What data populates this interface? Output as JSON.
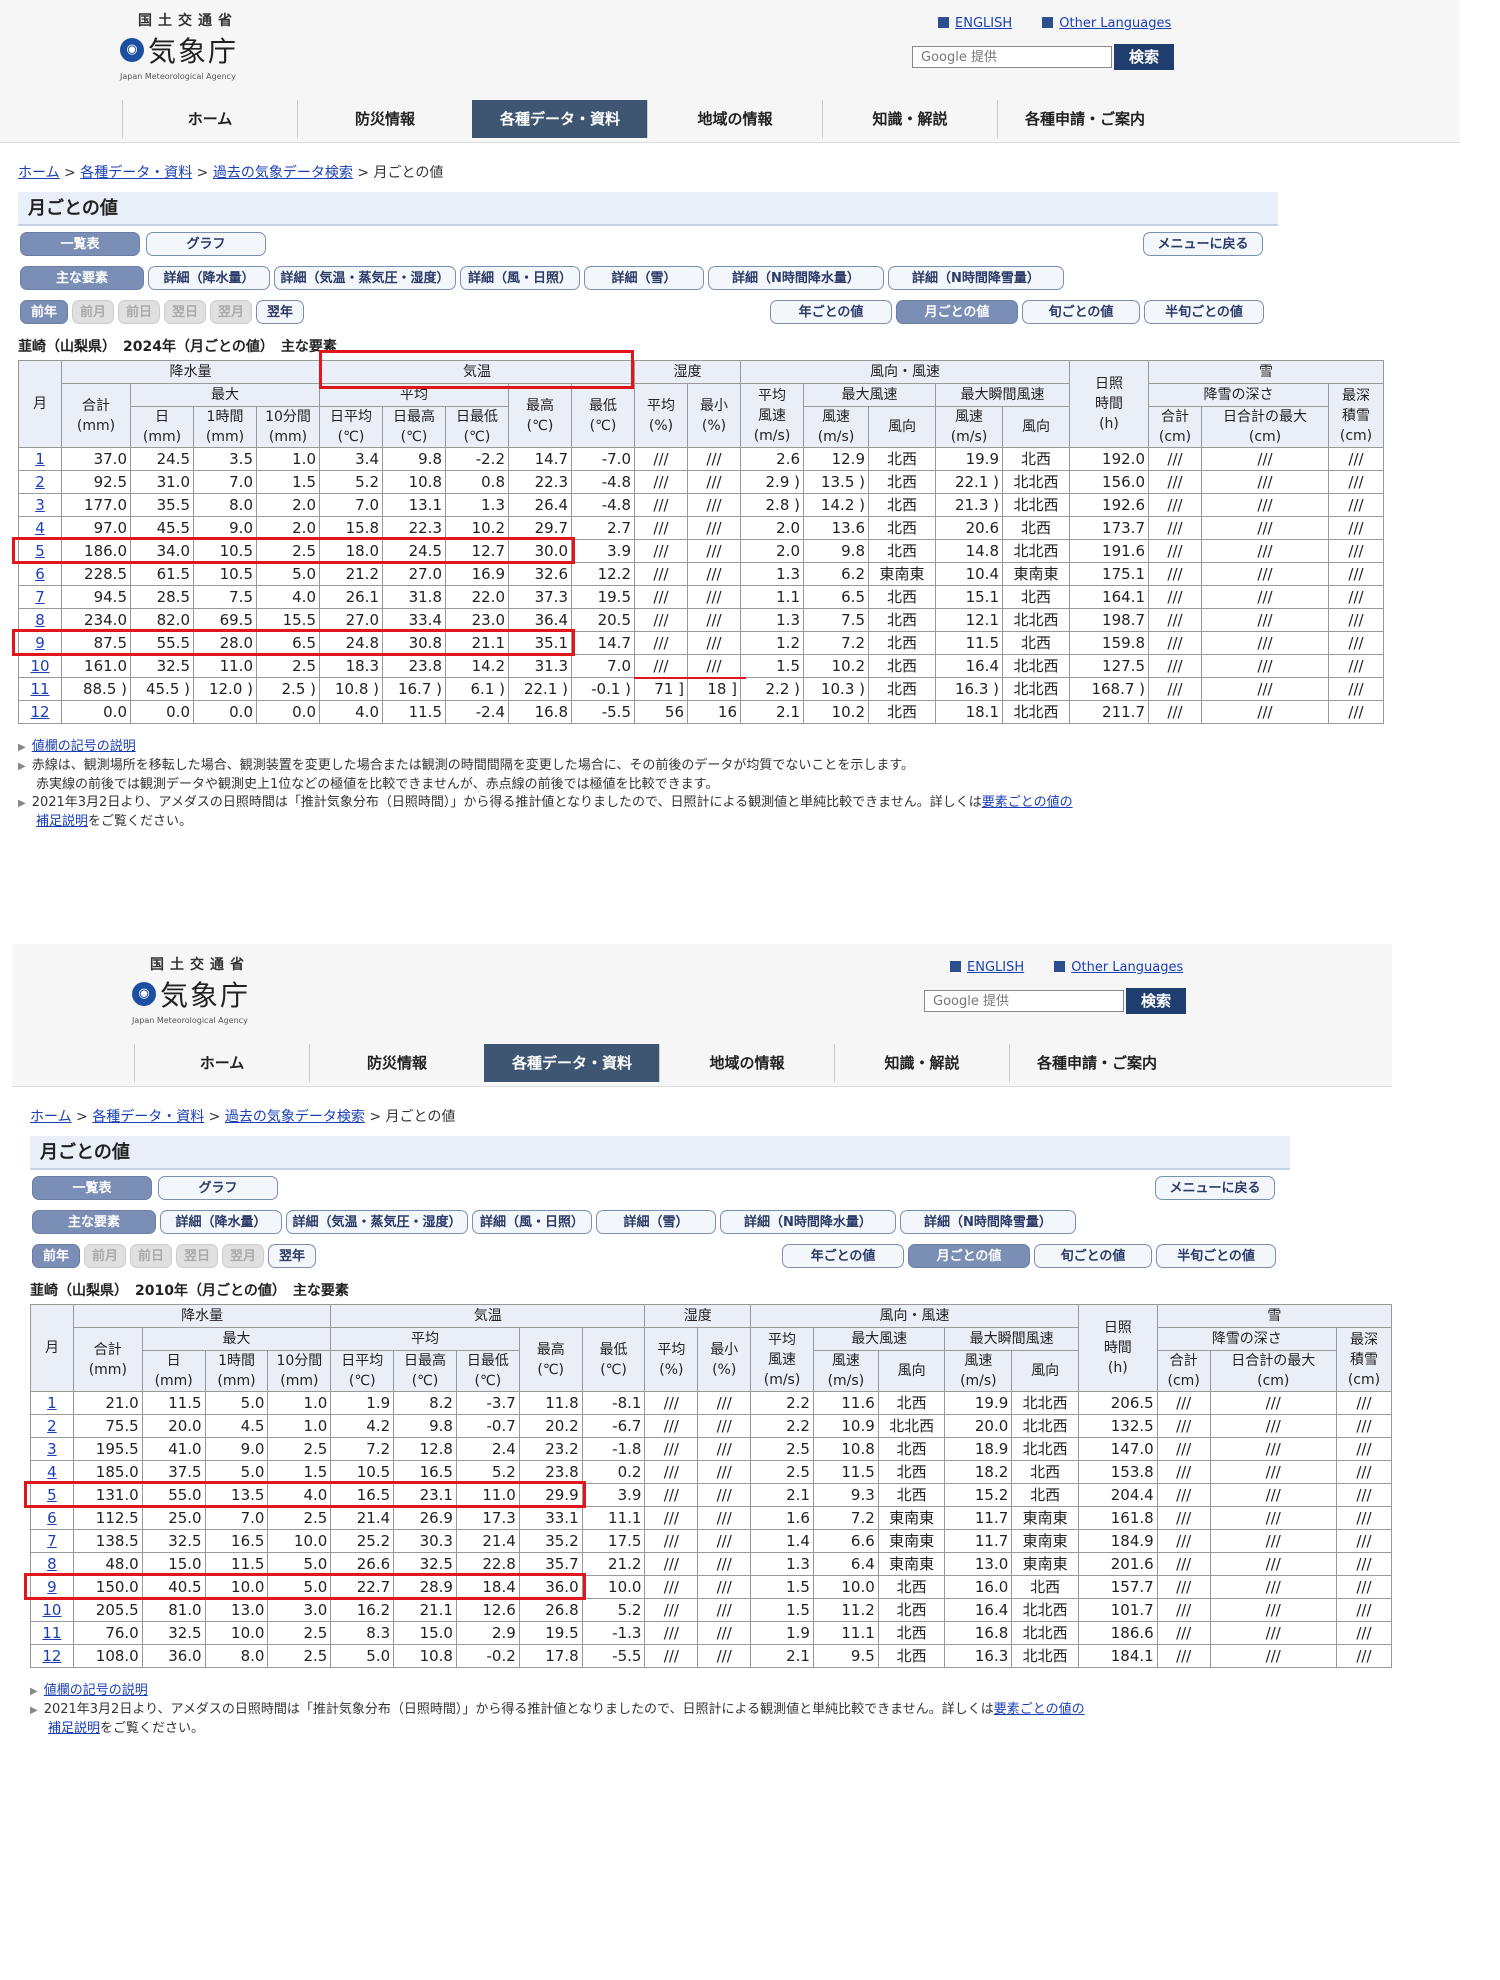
{
  "header": {
    "ministry": "国土交通省",
    "agency": "気象庁",
    "agency_en": "Japan Meteorological Agency",
    "english_link": "ENGLISH",
    "other_languages_link": "Other Languages",
    "search_placeholder": "Google 提供",
    "search_button": "検索"
  },
  "nav": [
    "ホーム",
    "防災情報",
    "各種データ・資料",
    "地域の情報",
    "知識・解説",
    "各種申請・ご案内"
  ],
  "breadcrumb": {
    "home": "ホーム",
    "data": "各種データ・資料",
    "past": "過去の気象データ検索",
    "current": "月ごとの値"
  },
  "page_title": "月ごとの値",
  "view_tabs": {
    "list": "一覧表",
    "graph": "グラフ",
    "back": "メニューに戻る"
  },
  "element_tabs": [
    "主な要素",
    "詳細（降水量）",
    "詳細（気温・蒸気圧・湿度）",
    "詳細（風・日照）",
    "詳細（雪）",
    "詳細（N時間降水量）",
    "詳細（N時間降雪量）"
  ],
  "period_nav": [
    "前年",
    "前月",
    "前日",
    "翌日",
    "翌月",
    "翌年"
  ],
  "interval_tabs": [
    "年ごとの値",
    "月ごとの値",
    "旬ごとの値",
    "半旬ごとの値"
  ],
  "headers": {
    "month": "月",
    "precip": "降水量",
    "max": "最大",
    "total": "合計",
    "total_unit": "(mm)",
    "day": "日",
    "hour1": "1時間",
    "min10": "10分間",
    "mm": "(mm)",
    "temp": "気温",
    "avg": "平均",
    "dailyavg": "日平均",
    "dailymax": "日最高",
    "dailymin": "日最低",
    "highest": "最高",
    "lowest": "最低",
    "deg": "(℃)",
    "humidity": "湿度",
    "hum_avg": "平均",
    "hum_min": "最小",
    "pct": "(%)",
    "wind": "風向・風速",
    "wind_avg": "平均",
    "wind_speed_label": "風速",
    "ms": "(m/s)",
    "max_wind": "最大風速",
    "max_gust": "最大瞬間風速",
    "speed": "風速",
    "dir": "風向",
    "sun": "日照",
    "sun_time": "時間",
    "hours": "(h)",
    "snow": "雪",
    "snow_depth": "降雪の深さ",
    "snow_total": "合計",
    "snow_daymax": "日合計の最大",
    "cm": "(cm)",
    "deepest": "最深",
    "deepest2": "積雪"
  },
  "note_links": {
    "symbols": "値欄の記号の説明",
    "supplement_a": "要素ごとの値の",
    "supplement_b": "補足説明"
  },
  "notes": {
    "redline_1": "赤線は、観測場所を移転した場合、観測装置を変更した場合または観測の時間間隔を変更した場合に、その前後のデータが均質でないことを示します。",
    "redline_2": "赤実線の前後では観測データや観測史上1位などの極値を比較できませんが、赤点線の前後では極値を比較できます。",
    "sunshine_a": "2021年3月2日より、アメダスの日照時間は「推計気象分布（日照時間）」から得る推計値となりましたので、日照計による観測値と単純比較できません。詳しくは",
    "sunshine_b": "をご覧ください。"
  },
  "tables": [
    {
      "label": "韮崎（山梨県）　2024年（月ごとの値）　主な要素",
      "rows": [
        [
          "1",
          "37.0",
          "24.5",
          "3.5",
          "1.0",
          "3.4",
          "9.8",
          "-2.2",
          "14.7",
          "-7.0",
          "///",
          "///",
          "2.6",
          "12.9",
          "北西",
          "19.9",
          "北西",
          "192.0",
          "///",
          "///",
          "///"
        ],
        [
          "2",
          "92.5",
          "31.0",
          "7.0",
          "1.5",
          "5.2",
          "10.8",
          "0.8",
          "22.3",
          "-4.8",
          "///",
          "///",
          "2.9 )",
          "13.5 )",
          "北西",
          "22.1 )",
          "北北西",
          "156.0",
          "///",
          "///",
          "///"
        ],
        [
          "3",
          "177.0",
          "35.5",
          "8.0",
          "2.0",
          "7.0",
          "13.1",
          "1.3",
          "26.4",
          "-4.8",
          "///",
          "///",
          "2.8 )",
          "14.2 )",
          "北西",
          "21.3 )",
          "北北西",
          "192.6",
          "///",
          "///",
          "///"
        ],
        [
          "4",
          "97.0",
          "45.5",
          "9.0",
          "2.0",
          "15.8",
          "22.3",
          "10.2",
          "29.7",
          "2.7",
          "///",
          "///",
          "2.0",
          "13.6",
          "北西",
          "20.6",
          "北西",
          "173.7",
          "///",
          "///",
          "///"
        ],
        [
          "5",
          "186.0",
          "34.0",
          "10.5",
          "2.5",
          "18.0",
          "24.5",
          "12.7",
          "30.0",
          "3.9",
          "///",
          "///",
          "2.0",
          "9.8",
          "北西",
          "14.8",
          "北北西",
          "191.6",
          "///",
          "///",
          "///"
        ],
        [
          "6",
          "228.5",
          "61.5",
          "10.5",
          "5.0",
          "21.2",
          "27.0",
          "16.9",
          "32.6",
          "12.2",
          "///",
          "///",
          "1.3",
          "6.2",
          "東南東",
          "10.4",
          "東南東",
          "175.1",
          "///",
          "///",
          "///"
        ],
        [
          "7",
          "94.5",
          "28.5",
          "7.5",
          "4.0",
          "26.1",
          "31.8",
          "22.0",
          "37.3",
          "19.5",
          "///",
          "///",
          "1.1",
          "6.5",
          "北西",
          "15.1",
          "北西",
          "164.1",
          "///",
          "///",
          "///"
        ],
        [
          "8",
          "234.0",
          "82.0",
          "69.5",
          "15.5",
          "27.0",
          "33.4",
          "23.0",
          "36.4",
          "20.5",
          "///",
          "///",
          "1.3",
          "7.5",
          "北西",
          "12.1",
          "北北西",
          "198.7",
          "///",
          "///",
          "///"
        ],
        [
          "9",
          "87.5",
          "55.5",
          "28.0",
          "6.5",
          "24.8",
          "30.8",
          "21.1",
          "35.1",
          "14.7",
          "///",
          "///",
          "1.2",
          "7.2",
          "北西",
          "11.5",
          "北西",
          "159.8",
          "///",
          "///",
          "///"
        ],
        [
          "10",
          "161.0",
          "32.5",
          "11.0",
          "2.5",
          "18.3",
          "23.8",
          "14.2",
          "31.3",
          "7.0",
          "///",
          "///",
          "1.5",
          "10.2",
          "北西",
          "16.4",
          "北北西",
          "127.5",
          "///",
          "///",
          "///"
        ],
        [
          "11",
          "88.5 )",
          "45.5 )",
          "12.0 )",
          "2.5 )",
          "10.8 )",
          "16.7 )",
          "6.1 )",
          "22.1 )",
          "-0.1 )",
          "71 ]",
          "18 ]",
          "2.2 )",
          "10.3 )",
          "北西",
          "16.3 )",
          "北北西",
          "168.7 )",
          "///",
          "///",
          "///"
        ],
        [
          "12",
          "0.0",
          "0.0",
          "0.0",
          "0.0",
          "4.0",
          "11.5",
          "-2.4",
          "16.8",
          "-5.5",
          "56",
          "16",
          "2.1",
          "10.2",
          "北西",
          "18.1",
          "北北西",
          "211.7",
          "///",
          "///",
          "///"
        ]
      ]
    },
    {
      "label": "韮崎（山梨県）　2010年（月ごとの値）　主な要素",
      "rows": [
        [
          "1",
          "21.0",
          "11.5",
          "5.0",
          "1.0",
          "1.9",
          "8.2",
          "-3.7",
          "11.8",
          "-8.1",
          "///",
          "///",
          "2.2",
          "11.6",
          "北西",
          "19.9",
          "北北西",
          "206.5",
          "///",
          "///",
          "///"
        ],
        [
          "2",
          "75.5",
          "20.0",
          "4.5",
          "1.0",
          "4.2",
          "9.8",
          "-0.7",
          "20.2",
          "-6.7",
          "///",
          "///",
          "2.2",
          "10.9",
          "北北西",
          "20.0",
          "北北西",
          "132.5",
          "///",
          "///",
          "///"
        ],
        [
          "3",
          "195.5",
          "41.0",
          "9.0",
          "2.5",
          "7.2",
          "12.8",
          "2.4",
          "23.2",
          "-1.8",
          "///",
          "///",
          "2.5",
          "10.8",
          "北西",
          "18.9",
          "北北西",
          "147.0",
          "///",
          "///",
          "///"
        ],
        [
          "4",
          "185.0",
          "37.5",
          "5.0",
          "1.5",
          "10.5",
          "16.5",
          "5.2",
          "23.8",
          "0.2",
          "///",
          "///",
          "2.5",
          "11.5",
          "北西",
          "18.2",
          "北西",
          "153.8",
          "///",
          "///",
          "///"
        ],
        [
          "5",
          "131.0",
          "55.0",
          "13.5",
          "4.0",
          "16.5",
          "23.1",
          "11.0",
          "29.9",
          "3.9",
          "///",
          "///",
          "2.1",
          "9.3",
          "北西",
          "15.2",
          "北西",
          "204.4",
          "///",
          "///",
          "///"
        ],
        [
          "6",
          "112.5",
          "25.0",
          "7.0",
          "2.5",
          "21.4",
          "26.9",
          "17.3",
          "33.1",
          "11.1",
          "///",
          "///",
          "1.6",
          "7.2",
          "東南東",
          "11.7",
          "東南東",
          "161.8",
          "///",
          "///",
          "///"
        ],
        [
          "7",
          "138.5",
          "32.5",
          "16.5",
          "10.0",
          "25.2",
          "30.3",
          "21.4",
          "35.2",
          "17.5",
          "///",
          "///",
          "1.4",
          "6.6",
          "東南東",
          "11.7",
          "東南東",
          "184.9",
          "///",
          "///",
          "///"
        ],
        [
          "8",
          "48.0",
          "15.0",
          "11.5",
          "5.0",
          "26.6",
          "32.5",
          "22.8",
          "35.7",
          "21.2",
          "///",
          "///",
          "1.3",
          "6.4",
          "東南東",
          "13.0",
          "東南東",
          "201.6",
          "///",
          "///",
          "///"
        ],
        [
          "9",
          "150.0",
          "40.5",
          "10.0",
          "5.0",
          "22.7",
          "28.9",
          "18.4",
          "36.0",
          "10.0",
          "///",
          "///",
          "1.5",
          "10.0",
          "北西",
          "16.0",
          "北西",
          "157.7",
          "///",
          "///",
          "///"
        ],
        [
          "10",
          "205.5",
          "81.0",
          "13.0",
          "3.0",
          "16.2",
          "21.1",
          "12.6",
          "26.8",
          "5.2",
          "///",
          "///",
          "1.5",
          "11.2",
          "北西",
          "16.4",
          "北北西",
          "101.7",
          "///",
          "///",
          "///"
        ],
        [
          "11",
          "76.0",
          "32.5",
          "10.0",
          "2.5",
          "8.3",
          "15.0",
          "2.9",
          "19.5",
          "-1.3",
          "///",
          "///",
          "1.9",
          "11.1",
          "北西",
          "16.8",
          "北北西",
          "186.6",
          "///",
          "///",
          "///"
        ],
        [
          "12",
          "108.0",
          "36.0",
          "8.0",
          "2.5",
          "5.0",
          "10.8",
          "-0.2",
          "17.8",
          "-5.5",
          "///",
          "///",
          "2.1",
          "9.5",
          "北西",
          "16.3",
          "北北西",
          "184.1",
          "///",
          "///",
          "///"
        ]
      ]
    }
  ]
}
